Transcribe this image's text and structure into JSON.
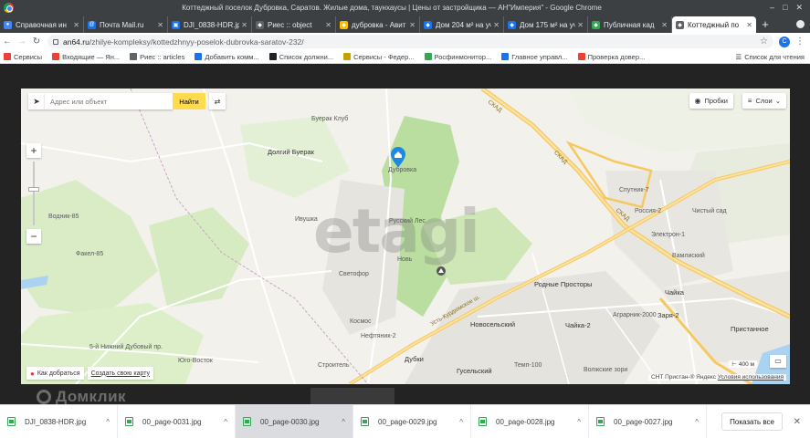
{
  "window": {
    "title": "Коттеджный поселок Дубровка, Саратов. Жилые дома, таунхаусы | Цены от застройщика — АН\"Империя\" - Google Chrome",
    "controls": [
      "–",
      "□",
      "✕"
    ]
  },
  "tabs": [
    {
      "label": "Справочная ин",
      "color": "#4285f4",
      "glyph": "●"
    },
    {
      "label": "Почта Mail.ru",
      "color": "#1a73e8",
      "glyph": "@"
    },
    {
      "label": "DJI_0838-HDR.jp",
      "color": "#1a73e8",
      "glyph": "▣"
    },
    {
      "label": "Риес :: object",
      "color": "#5f6368",
      "glyph": "◆"
    },
    {
      "label": "дубровка - Авит",
      "color": "#fbbc05",
      "glyph": "◆"
    },
    {
      "label": "Дом 204 м² на уч",
      "color": "#1a73e8",
      "glyph": "◆"
    },
    {
      "label": "Дом 175 м² на уч",
      "color": "#1a73e8",
      "glyph": "◆"
    },
    {
      "label": "Публичная кад",
      "color": "#34a853",
      "glyph": "◆"
    },
    {
      "label": "Коттеджный по",
      "color": "#5f6368",
      "glyph": "◆",
      "active": true
    }
  ],
  "toolbar": {
    "url_host": "an64.ru",
    "url_path": "/zhilye-kompleksy/kottedzhnyy-poselok-dubrovka-saratov-232/",
    "avatar": "С"
  },
  "bookmarks": [
    {
      "label": "Сервисы",
      "color": "#ea4335"
    },
    {
      "label": "Входящие — Ян...",
      "color": "#ea4335"
    },
    {
      "label": "Риес :: articles",
      "color": "#5f6368"
    },
    {
      "label": "Добавить комм...",
      "color": "#1a73e8"
    },
    {
      "label": "Список должни...",
      "color": "#202124"
    },
    {
      "label": "Сервисы - Федер...",
      "color": "#c5a100"
    },
    {
      "label": "Росфинмонитор...",
      "color": "#34a853"
    },
    {
      "label": "Главное управл...",
      "color": "#1a73e8"
    },
    {
      "label": "Проверка довер...",
      "color": "#ea4335"
    }
  ],
  "reading_list": "Список для чтения",
  "map": {
    "search_placeholder": "Адрес или объект",
    "search_button": "Найти",
    "traffic_button": "Пробки",
    "layers_button": "Слои",
    "watermark": "etagi",
    "directions": "Как добраться",
    "create_map": "Создать свою карту",
    "scale": "400 м",
    "copyright": "СНТ Пристан-® Яндекс",
    "terms": "Условия использования",
    "labels": {
      "bugrak_club": "Буерак Клуб",
      "dolgiy": "Долгий Буерак",
      "dubrovka": "Дубровка",
      "rodnye": "Родные Просторы",
      "novoselsky": "Новосельский",
      "chayka": "Чайка",
      "chayka2": "Чайка-2",
      "zarya": "Заря-2",
      "pristannoe": "Пристанное",
      "dubki": "Дубки",
      "guselsky": "Гусельский",
      "temp": "Темп-100",
      "volzhskie": "Волжские зори",
      "skad1": "СКАД",
      "skad2": "СКАД",
      "skad3": "СКАД",
      "kudr": "Усть-Курдюмское ш.",
      "vodnik": "Водник-85",
      "fakel": "Факел-85",
      "russkiy": "Русский Лес",
      "svetofor": "Светофор",
      "novy": "Новь",
      "yug": "Юго-Восток",
      "nizh": "5-й Нижний Дубовый пр.",
      "agrariy": "Аграрник-2000",
      "vamlik": "Вамлиский",
      "sputnik": "Спутник-7",
      "elektron": "Электрон-1",
      "rossiya": "Россия-2",
      "chistiy": "Чистый сад",
      "neftyanik": "Нефтяник-2",
      "rechka": "Ивушка",
      "stroitel": "Строитель",
      "kosmos": "Космос"
    }
  },
  "overlay": {
    "domclick": "Домклик"
  },
  "downloads": [
    {
      "name": "DJI_0838-HDR.jpg",
      "highlight": false
    },
    {
      "name": "00_page-0031.jpg",
      "highlight": false
    },
    {
      "name": "00_page-0030.jpg",
      "highlight": true
    },
    {
      "name": "00_page-0029.jpg",
      "highlight": false
    },
    {
      "name": "00_page-0028.jpg",
      "highlight": false
    },
    {
      "name": "00_page-0027.jpg",
      "highlight": false
    }
  ],
  "show_all": "Показать все"
}
